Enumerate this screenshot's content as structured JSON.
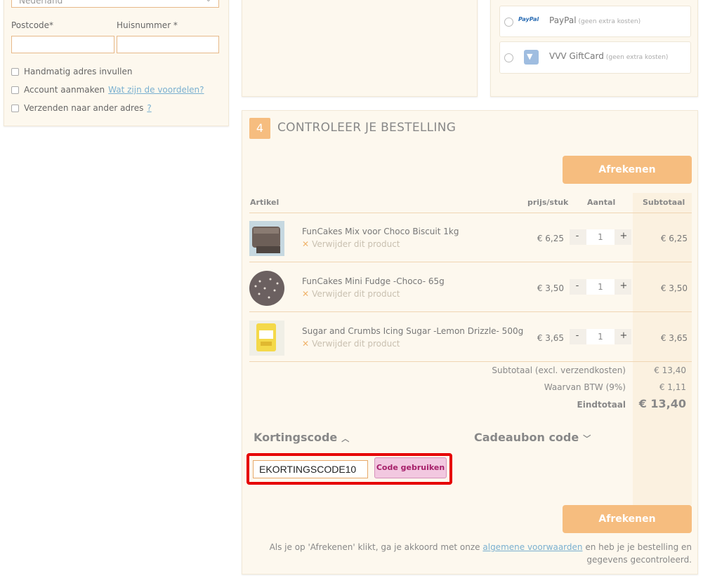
{
  "address": {
    "country_value": "Nederland",
    "postcode_label": "Postcode*",
    "huisnummer_label": "Huisnummer *",
    "checks": [
      {
        "label": "Handmatig adres invullen",
        "link": ""
      },
      {
        "label": "Account aanmaken",
        "link": "Wat zijn de voordelen?"
      },
      {
        "label": "Verzenden naar ander adres",
        "link": "?"
      }
    ]
  },
  "payment": {
    "options": [
      {
        "logo": "PayPal",
        "name": "PayPal",
        "fee": "(geen extra kosten)"
      },
      {
        "logo": "vvv-logo-icon",
        "name": "VVV GiftCard",
        "fee": "(geen extra kosten)"
      }
    ]
  },
  "order": {
    "step_number": "4",
    "step_title": "CONTROLEER JE BESTELLING",
    "checkout_label": "Afrekenen",
    "columns": {
      "artikel": "Artikel",
      "prijs": "prijs/stuk",
      "aantal": "Aantal",
      "subtotaal": "Subtotaal"
    },
    "remove_label": "Verwijder dit product",
    "products": [
      {
        "name": "FunCakes Mix voor Choco Biscuit 1kg",
        "price": "€ 6,25",
        "qty": "1",
        "subtotal": "€ 6,25"
      },
      {
        "name": "FunCakes Mini Fudge -Choco- 65g",
        "price": "€ 3,50",
        "qty": "1",
        "subtotal": "€ 3,50"
      },
      {
        "name": "Sugar and Crumbs Icing Sugar -Lemon Drizzle- 500g",
        "price": "€ 3,65",
        "qty": "1",
        "subtotal": "€ 3,65"
      }
    ],
    "totals": {
      "subtotal_label": "Subtotaal (excl. verzendkosten)",
      "subtotal_value": "€ 13,40",
      "btw_label": "Waarvan BTW (9%)",
      "btw_value": "€ 1,11",
      "total_label": "Eindtotaal",
      "total_value": "€ 13,40"
    },
    "discount": {
      "toggle_label": "Kortingscode",
      "gift_toggle_label": "Cadeaubon code",
      "code_value": "EKORTINGSCODE10",
      "apply_label": "Code gebruiken"
    },
    "footer": {
      "before": "Als je op 'Afrekenen' klikt, ga je akkoord met onze",
      "link": "algemene voorwaarden",
      "after": "en heb je je bestelling en gegevens gecontroleerd."
    }
  },
  "colors": {
    "accent": "#f6bd7f",
    "highlight": "#e60000",
    "panel_bg": "#fdf8ee"
  }
}
